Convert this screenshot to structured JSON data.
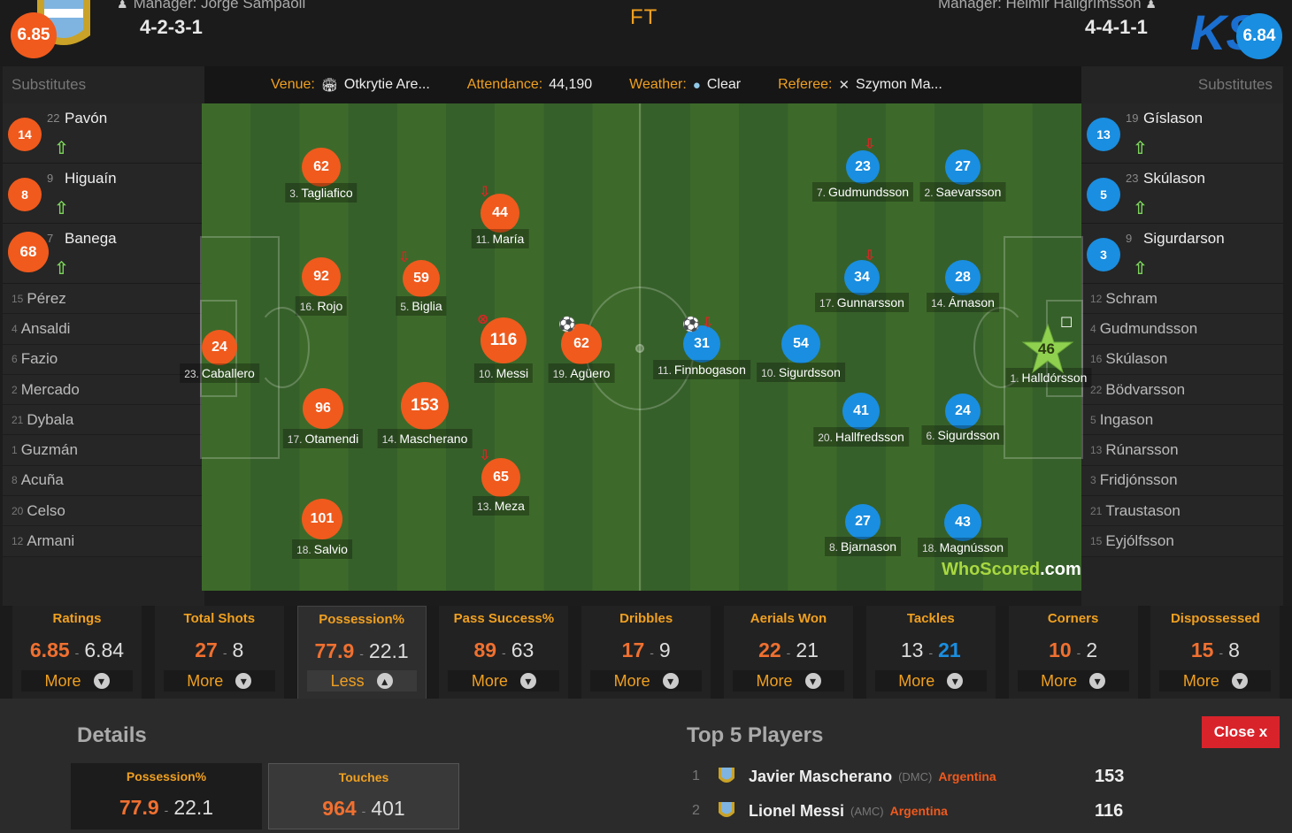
{
  "header": {
    "status": "FT",
    "home": {
      "rating": "6.85",
      "manager": "Manager: Jorge Sampaoli",
      "formation": "4-2-3-1"
    },
    "away": {
      "rating": "6.84",
      "manager": "Manager: Heimir Hallgrímsson",
      "formation": "4-4-1-1"
    }
  },
  "info": {
    "venue_label": "Venue:",
    "venue": "Otkrytie Are...",
    "attendance_label": "Attendance:",
    "attendance": "44,190",
    "weather_label": "Weather:",
    "weather": "Clear",
    "referee_label": "Referee:",
    "referee": "Szymon Ma..."
  },
  "subs_title": "Substitutes",
  "home_subs_in": [
    {
      "rating": "14",
      "num": "22",
      "name": "Pavón"
    },
    {
      "rating": "8",
      "num": "9",
      "name": "Higuaín"
    },
    {
      "rating": "68",
      "num": "7",
      "name": "Banega"
    }
  ],
  "home_subs_bench": [
    {
      "num": "15",
      "name": "Pérez"
    },
    {
      "num": "4",
      "name": "Ansaldi"
    },
    {
      "num": "6",
      "name": "Fazio"
    },
    {
      "num": "2",
      "name": "Mercado"
    },
    {
      "num": "21",
      "name": "Dybala"
    },
    {
      "num": "1",
      "name": "Guzmán"
    },
    {
      "num": "8",
      "name": "Acuña"
    },
    {
      "num": "20",
      "name": "Celso"
    },
    {
      "num": "12",
      "name": "Armani"
    }
  ],
  "away_subs_in": [
    {
      "rating": "13",
      "num": "19",
      "name": "Gíslason"
    },
    {
      "rating": "5",
      "num": "23",
      "name": "Skúlason"
    },
    {
      "rating": "3",
      "num": "9",
      "name": "Sigurdarson"
    }
  ],
  "away_subs_bench": [
    {
      "num": "12",
      "name": "Schram"
    },
    {
      "num": "4",
      "name": "Gudmundsson"
    },
    {
      "num": "16",
      "name": "Skúlason"
    },
    {
      "num": "22",
      "name": "Bödvarsson"
    },
    {
      "num": "5",
      "name": "Ingason"
    },
    {
      "num": "13",
      "name": "Rúnarsson"
    },
    {
      "num": "3",
      "name": "Fridjónsson"
    },
    {
      "num": "21",
      "name": "Traustason"
    },
    {
      "num": "15",
      "name": "Eyjólfsson"
    }
  ],
  "home_players": [
    {
      "rating": "62",
      "num": "3.",
      "name": "Tagliafico"
    },
    {
      "rating": "44",
      "num": "11.",
      "name": "María"
    },
    {
      "rating": "92",
      "num": "16.",
      "name": "Rojo"
    },
    {
      "rating": "59",
      "num": "5.",
      "name": "Biglia"
    },
    {
      "rating": "24",
      "num": "23.",
      "name": "Caballero"
    },
    {
      "rating": "116",
      "num": "10.",
      "name": "Messi"
    },
    {
      "rating": "62",
      "num": "19.",
      "name": "Agüero"
    },
    {
      "rating": "96",
      "num": "17.",
      "name": "Otamendi"
    },
    {
      "rating": "153",
      "num": "14.",
      "name": "Mascherano"
    },
    {
      "rating": "65",
      "num": "13.",
      "name": "Meza"
    },
    {
      "rating": "101",
      "num": "18.",
      "name": "Salvio"
    }
  ],
  "away_players": [
    {
      "rating": "23",
      "num": "7.",
      "name": "Gudmundsson"
    },
    {
      "rating": "27",
      "num": "2.",
      "name": "Saevarsson"
    },
    {
      "rating": "34",
      "num": "17.",
      "name": "Gunnarsson"
    },
    {
      "rating": "28",
      "num": "14.",
      "name": "Árnason"
    },
    {
      "rating": "31",
      "num": "11.",
      "name": "Finnbogason"
    },
    {
      "rating": "54",
      "num": "10.",
      "name": "Sigurdsson"
    },
    {
      "rating": "46",
      "num": "1.",
      "name": "Halldórsson"
    },
    {
      "rating": "41",
      "num": "20.",
      "name": "Hallfredsson"
    },
    {
      "rating": "24",
      "num": "6.",
      "name": "Sigurdsson"
    },
    {
      "rating": "27",
      "num": "8.",
      "name": "Bjarnason"
    },
    {
      "rating": "43",
      "num": "18.",
      "name": "Magnússon"
    }
  ],
  "watermark": {
    "a": "WhoScored",
    "b": ".com"
  },
  "stats": [
    {
      "title": "Ratings",
      "home": "6.85",
      "away": "6.84",
      "btn": "More"
    },
    {
      "title": "Total Shots",
      "home": "27",
      "away": "8",
      "btn": "More"
    },
    {
      "title": "Possession%",
      "home": "77.9",
      "away": "22.1",
      "btn": "Less"
    },
    {
      "title": "Pass Success%",
      "home": "89",
      "away": "63",
      "btn": "More"
    },
    {
      "title": "Dribbles",
      "home": "17",
      "away": "9",
      "btn": "More"
    },
    {
      "title": "Aerials Won",
      "home": "22",
      "away": "21",
      "btn": "More"
    },
    {
      "title": "Tackles",
      "home": "13",
      "away": "21",
      "btn": "More"
    },
    {
      "title": "Corners",
      "home": "10",
      "away": "2",
      "btn": "More"
    },
    {
      "title": "Dispossessed",
      "home": "15",
      "away": "8",
      "btn": "More"
    }
  ],
  "details": {
    "title": "Details",
    "boxes": [
      {
        "title": "Possession%",
        "home": "77.9",
        "away": "22.1"
      },
      {
        "title": "Touches",
        "home": "964",
        "away": "401"
      }
    ]
  },
  "top5": {
    "title": "Top 5 Players",
    "close": "Close x",
    "rows": [
      {
        "rank": "1",
        "name": "Javier Mascherano",
        "pos": "(DMC)",
        "team": "Argentina",
        "score": "153"
      },
      {
        "rank": "2",
        "name": "Lionel Messi",
        "pos": "(AMC)",
        "team": "Argentina",
        "score": "116"
      }
    ]
  },
  "colors": {
    "home": "#f05a1d",
    "away": "#1a8ee0",
    "accent": "#f0a020",
    "close": "#d9232b"
  }
}
